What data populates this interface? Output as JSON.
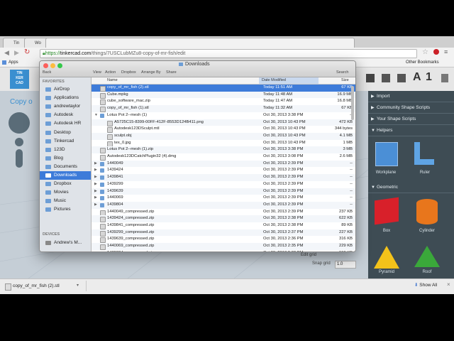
{
  "browser": {
    "tabs": [
      {
        "label": "Tin",
        "active": false
      },
      {
        "label": "Wo",
        "active": false
      },
      {
        "label": "",
        "active": true
      }
    ],
    "url_protocol": "https://",
    "url_host": "tinkercad.com",
    "url_path": "/things/7USCLubMZu8-copy-of-mr-fish/edit",
    "bookmarks": [
      "Apps"
    ],
    "other_bookmarks": "Other Bookmarks"
  },
  "tinkercad": {
    "logo_rows": [
      "TIN",
      "KER",
      "CAD"
    ],
    "design_title": "Copy o",
    "view_icons": [
      "grid-icon",
      "cube-icon",
      "cubes-icon"
    ],
    "header_letters": [
      "A",
      "1"
    ],
    "panel": {
      "rows": [
        "Import",
        "Community Shape Scripts",
        "Your Shape Scripts",
        "Helpers"
      ],
      "helpers": [
        "Workplane",
        "Ruler"
      ],
      "geometric_header": "Geometric",
      "shapes": [
        "Box",
        "Cylinder",
        "Pyramid",
        "Roof"
      ]
    },
    "snap_grid_label": "Snap grid",
    "snap_grid_value": "1.0",
    "edit_grid_label": "Edit grid"
  },
  "finder": {
    "title": "Downloads",
    "toolbar": [
      "Back",
      "View",
      "Action",
      "Dropbox",
      "Arrange By",
      "Share",
      "Search"
    ],
    "favorites_header": "FAVORITES",
    "favorites": [
      "AirDrop",
      "Applications",
      "andrewtaylor",
      "Autodesk",
      "Autodesk HR",
      "Desktop",
      "Tinkercad",
      "123D",
      "Blog",
      "Documents",
      "Downloads",
      "Dropbox",
      "Movies",
      "Music",
      "Pictures"
    ],
    "selected_favorite": "Downloads",
    "devices_header": "DEVICES",
    "devices": [
      "Andrew's M..."
    ],
    "columns": {
      "name": "Name",
      "date": "Date Modified",
      "size": "Size"
    },
    "files": [
      {
        "name": "copy_of_mr_fish (2).stl",
        "date": "Today 11:51 AM",
        "size": "67 KB",
        "indent": 0,
        "folder": false,
        "disc": ""
      },
      {
        "name": "Cube.mpkg",
        "date": "Today 11:48 AM",
        "size": "16.9 MB",
        "indent": 0,
        "folder": false,
        "disc": ""
      },
      {
        "name": "cube_software_mac.zip",
        "date": "Today 11:47 AM",
        "size": "16.8 MB",
        "indent": 0,
        "folder": false,
        "disc": ""
      },
      {
        "name": "copy_of_mr_fish (1).stl",
        "date": "Today 11:32 AM",
        "size": "67 KB",
        "indent": 0,
        "folder": false,
        "disc": ""
      },
      {
        "name": "Lotus Pot 2--mesh (1)",
        "date": "Oct 30, 2013 3:38 PM",
        "size": "--",
        "indent": 0,
        "folder": true,
        "disc": "▼"
      },
      {
        "name": "A5725C15-8399-00FF-412F-8553D124B411.png",
        "date": "Oct 30, 2013 10:43 PM",
        "size": "472 KB",
        "indent": 1,
        "folder": false,
        "disc": ""
      },
      {
        "name": "Autodesk123DSculpt.mtl",
        "date": "Oct 30, 2013 10:43 PM",
        "size": "344 bytes",
        "indent": 1,
        "folder": false,
        "disc": ""
      },
      {
        "name": "sculpt.obj",
        "date": "Oct 30, 2013 10:43 PM",
        "size": "4.1 MB",
        "indent": 1,
        "folder": false,
        "disc": ""
      },
      {
        "name": "tex_0.jpg",
        "date": "Oct 30, 2013 10:43 PM",
        "size": "1 MB",
        "indent": 1,
        "folder": false,
        "disc": ""
      },
      {
        "name": "Lotus Pot 2--mesh (1).zip",
        "date": "Oct 30, 2013 3:38 PM",
        "size": "3 MB",
        "indent": 0,
        "folder": false,
        "disc": ""
      },
      {
        "name": "Autodesk123DCatchPlugin32 (4).dmg",
        "date": "Oct 30, 2013 3:08 PM",
        "size": "2.6 MB",
        "indent": 0,
        "folder": false,
        "disc": ""
      },
      {
        "name": "1440049",
        "date": "Oct 30, 2013 2:39 PM",
        "size": "--",
        "indent": 0,
        "folder": true,
        "disc": "▶"
      },
      {
        "name": "1439424",
        "date": "Oct 30, 2013 2:39 PM",
        "size": "--",
        "indent": 0,
        "folder": true,
        "disc": "▶"
      },
      {
        "name": "1439841",
        "date": "Oct 30, 2013 2:39 PM",
        "size": "--",
        "indent": 0,
        "folder": true,
        "disc": "▶"
      },
      {
        "name": "1439299",
        "date": "Oct 30, 2013 2:39 PM",
        "size": "--",
        "indent": 0,
        "folder": true,
        "disc": "▶"
      },
      {
        "name": "1439639",
        "date": "Oct 30, 2013 2:39 PM",
        "size": "--",
        "indent": 0,
        "folder": true,
        "disc": "▶"
      },
      {
        "name": "1440069",
        "date": "Oct 30, 2013 2:39 PM",
        "size": "--",
        "indent": 0,
        "folder": true,
        "disc": "▶"
      },
      {
        "name": "1439804",
        "date": "Oct 30, 2013 2:39 PM",
        "size": "--",
        "indent": 0,
        "folder": true,
        "disc": "▶"
      },
      {
        "name": "1440049_compressed.zip",
        "date": "Oct 30, 2013 2:39 PM",
        "size": "237 KB",
        "indent": 0,
        "folder": false,
        "disc": ""
      },
      {
        "name": "1439424_compressed.zip",
        "date": "Oct 30, 2013 2:38 PM",
        "size": "622 KB",
        "indent": 0,
        "folder": false,
        "disc": ""
      },
      {
        "name": "1439841_compressed.zip",
        "date": "Oct 30, 2013 2:38 PM",
        "size": "89 KB",
        "indent": 0,
        "folder": false,
        "disc": ""
      },
      {
        "name": "1439299_compressed.zip",
        "date": "Oct 30, 2013 2:37 PM",
        "size": "227 KB",
        "indent": 0,
        "folder": false,
        "disc": ""
      },
      {
        "name": "1439639_compressed.zip",
        "date": "Oct 30, 2013 2:36 PM",
        "size": "316 KB",
        "indent": 0,
        "folder": false,
        "disc": ""
      },
      {
        "name": "1440069_compressed.zip",
        "date": "Oct 30, 2013 2:35 PM",
        "size": "229 KB",
        "indent": 0,
        "folder": false,
        "disc": ""
      },
      {
        "name": "1439804_compressed.zip",
        "date": "Oct 30, 2013 2:32 PM",
        "size": "159 KB",
        "indent": 0,
        "folder": false,
        "disc": ""
      }
    ]
  },
  "download_bar": {
    "item": "copy_of_mr_fish (2).stl",
    "show_all": "Show All"
  },
  "colors": {
    "selection": "#3d7bd9",
    "panel_bg": "#3e4c54",
    "box": "#d8202a",
    "cylinder": "#e8761c",
    "pyramid": "#f3c21a",
    "roof": "#3aa83a"
  }
}
